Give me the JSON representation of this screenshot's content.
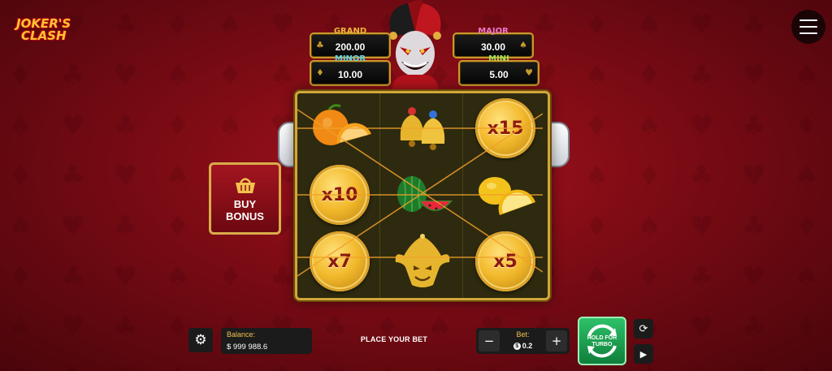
{
  "game": {
    "logo_line1": "JOKER'S",
    "logo_line2": "CLASH"
  },
  "jackpots": [
    {
      "label": "GRAND",
      "value": "200.00",
      "label_color": "#e8b93a"
    },
    {
      "label": "MAJOR",
      "value": "30.00",
      "label_color": "#e879c9"
    },
    {
      "label": "MINOR",
      "value": "10.00",
      "label_color": "#5ad3e6"
    },
    {
      "label": "MINI",
      "value": "5.00",
      "label_color": "#9be05a"
    }
  ],
  "reels": {
    "rows": [
      [
        "orange",
        "bells",
        "coin"
      ],
      [
        "coin",
        "watermelon",
        "lemon"
      ],
      [
        "coin",
        "jester-mask",
        "coin"
      ]
    ],
    "coin_values": {
      "r0c2": "x15",
      "r1c0": "x10",
      "r2c0": "x7",
      "r2c2": "x5"
    }
  },
  "buy_bonus": {
    "line1": "BUY",
    "line2": "BONUS"
  },
  "bottom_bar": {
    "balance_label": "Balance:",
    "balance_value": "$ 999 988.6",
    "status": "PLACE YOUR BET",
    "bet_label": "Bet:",
    "bet_value": "0.2",
    "spin_label_line1": "HOLD FOR",
    "spin_label_line2": "TURBO"
  },
  "colors": {
    "background": "#8b0d17",
    "frame_gold": "#d1a63a",
    "spin_green": "#1ea152"
  },
  "icons": [
    "menu-icon",
    "settings-icon",
    "basket-icon",
    "autoplay-icon",
    "play-icon",
    "spin-arrows-icon"
  ]
}
